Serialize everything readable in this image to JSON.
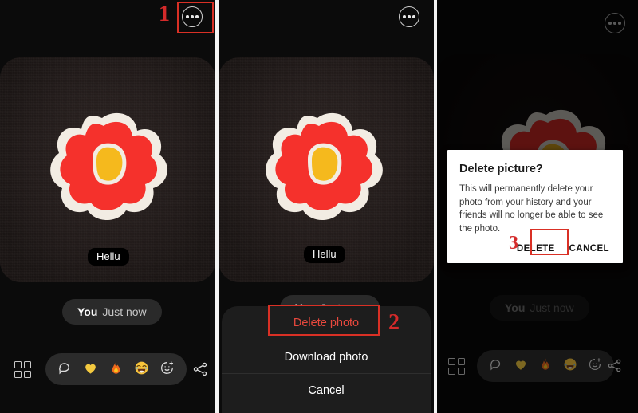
{
  "tutorial": {
    "step_numbers": [
      "1",
      "2",
      "3"
    ],
    "highlight_color": "#d93025",
    "number_color": "#d42a2a"
  },
  "panel1": {
    "more_button": "more-options",
    "photo": {
      "caption": "Hellu",
      "sticker": "red-flower-sticker"
    },
    "meta": {
      "author": "You",
      "time": "Just now"
    },
    "bottom": {
      "grid_label": "grid-icon",
      "reactions": [
        "chat-bubble-icon",
        "yellow-heart-emoji",
        "fire-emoji",
        "joy-emoji",
        "add-reaction-icon"
      ],
      "reaction_glyphs": [
        "○",
        "💛",
        "🔥",
        "😂",
        "☺"
      ],
      "share_label": "share-icon"
    }
  },
  "panel2": {
    "photo": {
      "caption": "Hellu",
      "sticker": "red-flower-sticker"
    },
    "meta": {
      "author": "You",
      "time": "Just now"
    },
    "sheet": {
      "items": [
        {
          "label": "Delete photo",
          "style": "danger"
        },
        {
          "label": "Download photo",
          "style": "normal"
        },
        {
          "label": "Cancel",
          "style": "normal"
        }
      ]
    }
  },
  "panel3": {
    "photo": {
      "sticker": "red-flower-sticker"
    },
    "meta": {
      "author": "You",
      "time": "Just now"
    },
    "dialog": {
      "title": "Delete picture?",
      "body": "This will permanently delete your photo from your history and your friends will no longer be able to see the photo.",
      "confirm_label": "DELETE",
      "cancel_label": "CANCEL"
    },
    "bottom": {
      "grid_label": "grid-icon",
      "reaction_glyphs": [
        "○",
        "💛",
        "🔥",
        "😂",
        "☺"
      ],
      "share_label": "share-icon"
    }
  },
  "colors": {
    "sticker_red": "#f5312c",
    "sticker_white": "#f2ece3",
    "sticker_yellow": "#f5b91d",
    "danger_text": "#e8483d",
    "sheet_bg": "#1d1d1d",
    "dialog_bg": "#ffffff"
  }
}
